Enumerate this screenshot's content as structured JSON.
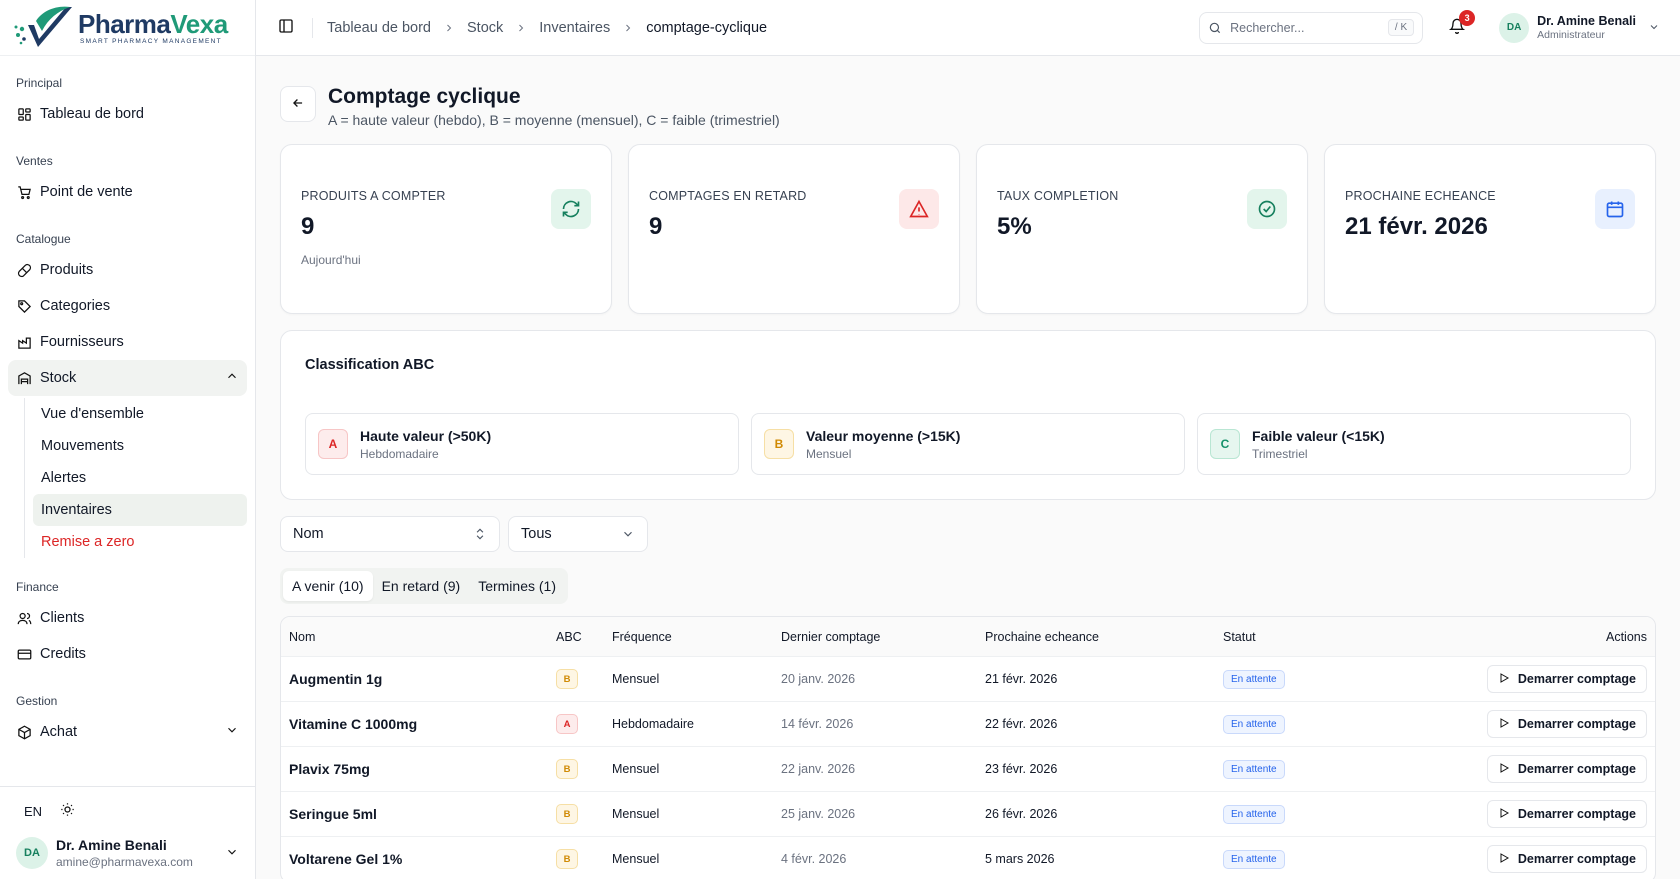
{
  "brand": {
    "name_part1": "Pharma",
    "name_part2": "Vexa",
    "tagline": "SMART PHARMACY MANAGEMENT",
    "colors": {
      "navy": "#1f3a63",
      "green": "#1f9a78"
    }
  },
  "sidebar": {
    "sections": {
      "principal": "Principal",
      "ventes": "Ventes",
      "catalogue": "Catalogue",
      "finance": "Finance",
      "gestion": "Gestion"
    },
    "items": {
      "dashboard": "Tableau de bord",
      "pos": "Point de vente",
      "produits": "Produits",
      "categories": "Categories",
      "fournisseurs": "Fournisseurs",
      "stock": "Stock",
      "clients": "Clients",
      "credits": "Credits",
      "achat": "Achat"
    },
    "stock_sub": {
      "overview": "Vue d'ensemble",
      "mouvements": "Mouvements",
      "alertes": "Alertes",
      "inventaires": "Inventaires",
      "reset": "Remise a zero"
    },
    "lang": "EN",
    "user": {
      "initials": "DA",
      "name": "Dr. Amine Benali",
      "email": "amine@pharmavexa.com"
    }
  },
  "topbar": {
    "breadcrumbs": [
      "Tableau de bord",
      "Stock",
      "Inventaires",
      "comptage-cyclique"
    ],
    "search_placeholder": "Rechercher...",
    "search_shortcut": "/ K",
    "notifications_count": "3",
    "user": {
      "initials": "DA",
      "name": "Dr. Amine Benali",
      "role": "Administrateur"
    }
  },
  "page": {
    "title": "Comptage cyclique",
    "subtitle": "A = haute valeur (hebdo), B = moyenne (mensuel), C = faible (trimestriel)"
  },
  "kpis": [
    {
      "label": "PRODUITS A COMPTER",
      "value": "9",
      "hint": "Aujourd'hui",
      "icon": "refresh-icon",
      "icon_bg": "#e3f5ec",
      "icon_color": "#16805e"
    },
    {
      "label": "COMPTAGES EN RETARD",
      "value": "9",
      "hint": "",
      "icon": "alert-triangle-icon",
      "icon_bg": "#fde8e8",
      "icon_color": "#dc2626"
    },
    {
      "label": "TAUX COMPLETION",
      "value": "5%",
      "hint": "",
      "icon": "check-circle-icon",
      "icon_bg": "#e3f5ec",
      "icon_color": "#16805e"
    },
    {
      "label": "PROCHAINE ECHEANCE",
      "value": "21 févr. 2026",
      "hint": "",
      "icon": "calendar-icon",
      "icon_bg": "#e8f0fe",
      "icon_color": "#2563eb"
    }
  ],
  "abc": {
    "title": "Classification ABC",
    "classes": [
      {
        "letter": "A",
        "name": "Haute valeur (>50K)",
        "freq": "Hebdomadaire"
      },
      {
        "letter": "B",
        "name": "Valeur moyenne (>15K)",
        "freq": "Mensuel"
      },
      {
        "letter": "C",
        "name": "Faible valeur (<15K)",
        "freq": "Trimestriel"
      }
    ]
  },
  "filters": {
    "sort": "Nom",
    "class": "Tous"
  },
  "tabs": [
    "A venir (10)",
    "En retard (9)",
    "Termines (1)"
  ],
  "table": {
    "headers": {
      "nom": "Nom",
      "abc": "ABC",
      "freq": "Fréquence",
      "last": "Dernier comptage",
      "next": "Prochaine echeance",
      "stat": "Statut",
      "act": "Actions"
    },
    "action_label": "Demarrer comptage",
    "rows": [
      {
        "nom": "Augmentin 1g",
        "abc": "B",
        "freq": "Mensuel",
        "last": "20 janv. 2026",
        "next": "21 févr. 2026",
        "stat": "En attente"
      },
      {
        "nom": "Vitamine C 1000mg",
        "abc": "A",
        "freq": "Hebdomadaire",
        "last": "14 févr. 2026",
        "next": "22 févr. 2026",
        "stat": "En attente"
      },
      {
        "nom": "Plavix 75mg",
        "abc": "B",
        "freq": "Mensuel",
        "last": "22 janv. 2026",
        "next": "23 févr. 2026",
        "stat": "En attente"
      },
      {
        "nom": "Seringue 5ml",
        "abc": "B",
        "freq": "Mensuel",
        "last": "25 janv. 2026",
        "next": "26 févr. 2026",
        "stat": "En attente"
      },
      {
        "nom": "Voltarene Gel 1%",
        "abc": "B",
        "freq": "Mensuel",
        "last": "4 févr. 2026",
        "next": "5 mars 2026",
        "stat": "En attente"
      }
    ]
  }
}
